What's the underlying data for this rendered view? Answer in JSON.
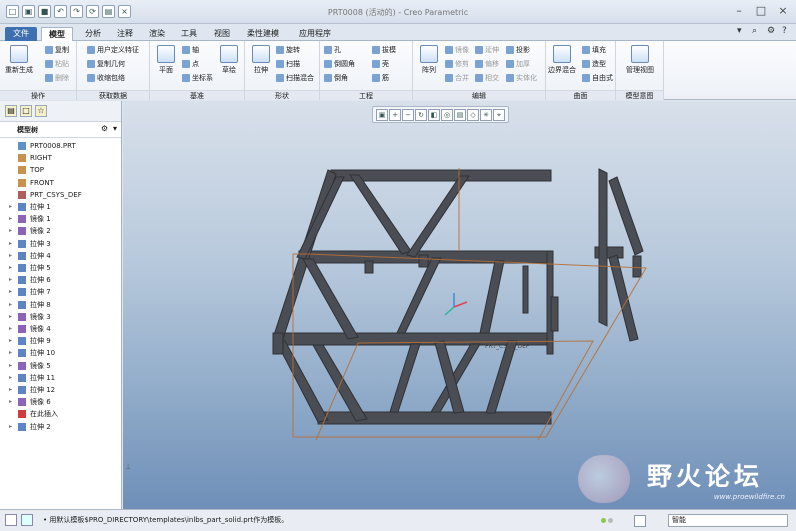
{
  "window": {
    "title": "PRT0008 (活动的) - Creo Parametric"
  },
  "tabs": [
    {
      "label": "文件",
      "file": true
    },
    {
      "label": "模型",
      "active": true
    },
    {
      "label": "分析"
    },
    {
      "label": "注释"
    },
    {
      "label": "渲染"
    },
    {
      "label": "工具"
    },
    {
      "label": "视图"
    },
    {
      "label": "柔性建模"
    },
    {
      "label": "应用程序"
    }
  ],
  "ribbon": {
    "regen": "重新生成",
    "copy": "复制",
    "paste": "粘贴",
    "delete": "删除",
    "udf": "用户定义特征",
    "copy_geom": "复制几何",
    "shrink": "收缩包络",
    "plane": "平面",
    "axis": "轴",
    "point": "点",
    "csys": "坐标系",
    "sketch": "草绘",
    "extrude": "拉伸",
    "revolve": "旋转",
    "sweep": "扫描",
    "swept_blend": "扫描混合",
    "hole": "孔",
    "round": "倒圆角",
    "chamfer": "倒角",
    "draft": "拔模",
    "shell": "壳",
    "rib": "筋",
    "pattern": "阵列",
    "mirror": "镜像",
    "extend": "延伸",
    "project": "投影",
    "trim": "修剪",
    "offset": "偏移",
    "thicken": "加厚",
    "merge": "合并",
    "intersect": "相交",
    "solidify": "实体化",
    "boundary_blend": "边界混合",
    "fill": "填充",
    "style": "造型",
    "freestyle": "自由式",
    "manager_view": "管理视图",
    "groups": [
      "操作",
      "获取数据",
      "基准",
      "形状",
      "工程",
      "编辑",
      "曲面",
      "模型意图"
    ]
  },
  "model_tree": {
    "title": "模型树",
    "items": [
      {
        "label": "PRT0008.PRT",
        "type": "part",
        "expand": false
      },
      {
        "label": "RIGHT",
        "type": "plane",
        "expand": false
      },
      {
        "label": "TOP",
        "type": "plane",
        "expand": false
      },
      {
        "label": "FRONT",
        "type": "plane",
        "expand": false
      },
      {
        "label": "PRT_CSYS_DEF",
        "type": "csys",
        "expand": false
      },
      {
        "label": "拉伸 1",
        "type": "extrude",
        "expand": true
      },
      {
        "label": "镜像 1",
        "type": "mirror",
        "expand": true
      },
      {
        "label": "镜像 2",
        "type": "mirror",
        "expand": true
      },
      {
        "label": "拉伸 3",
        "type": "extrude",
        "expand": true
      },
      {
        "label": "拉伸 4",
        "type": "extrude",
        "expand": true
      },
      {
        "label": "拉伸 5",
        "type": "extrude",
        "expand": true
      },
      {
        "label": "拉伸 6",
        "type": "extrude",
        "expand": true
      },
      {
        "label": "拉伸 7",
        "type": "extrude",
        "expand": true
      },
      {
        "label": "拉伸 8",
        "type": "extrude",
        "expand": true
      },
      {
        "label": "镜像 3",
        "type": "mirror",
        "expand": true
      },
      {
        "label": "镜像 4",
        "type": "mirror",
        "expand": true
      },
      {
        "label": "拉伸 9",
        "type": "extrude",
        "expand": true
      },
      {
        "label": "拉伸 10",
        "type": "extrude",
        "expand": true
      },
      {
        "label": "镜像 5",
        "type": "mirror",
        "expand": true
      },
      {
        "label": "拉伸 11",
        "type": "extrude",
        "expand": true
      },
      {
        "label": "拉伸 12",
        "type": "extrude",
        "expand": true
      },
      {
        "label": "镜像 6",
        "type": "mirror",
        "expand": true
      },
      {
        "label": "在此插入",
        "type": "insert",
        "expand": false
      },
      {
        "label": "拉伸 2",
        "type": "extrude",
        "expand": true
      }
    ]
  },
  "viewport": {
    "csys_label": "PRT_CSYS_DEF"
  },
  "status": {
    "message": "• 用默认模板$PRO_DIRECTORY\\templates\\inlbs_part_solid.prt作为模板。",
    "filter": "智能"
  },
  "watermark": {
    "text": "野火论坛",
    "url": "www.proewildfire.cn"
  }
}
